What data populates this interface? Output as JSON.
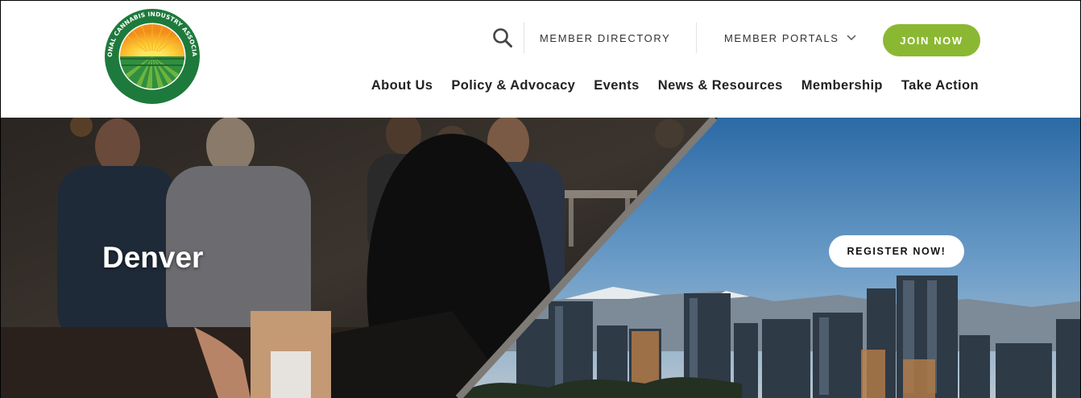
{
  "logo": {
    "arc_text": "NATIONAL CANNABIS INDUSTRY ASSOCIATION",
    "icon": "nca-logo"
  },
  "utility_nav": {
    "search_icon": "search-icon",
    "member_directory": "MEMBER DIRECTORY",
    "member_portals": "MEMBER PORTALS",
    "portals_icon": "chevron-down-icon",
    "join_now": "JOIN NOW"
  },
  "main_nav": {
    "items": [
      {
        "label": "About Us"
      },
      {
        "label": "Policy & Advocacy"
      },
      {
        "label": "Events"
      },
      {
        "label": "News & Resources"
      },
      {
        "label": "Membership"
      },
      {
        "label": "Take Action"
      }
    ]
  },
  "hero": {
    "title": "Denver",
    "register_label": "REGISTER NOW!"
  },
  "colors": {
    "brand_green": "#1e7a3c",
    "join_green": "#8bb832",
    "sun_orange": "#f5a623",
    "text_dark": "#222222"
  }
}
